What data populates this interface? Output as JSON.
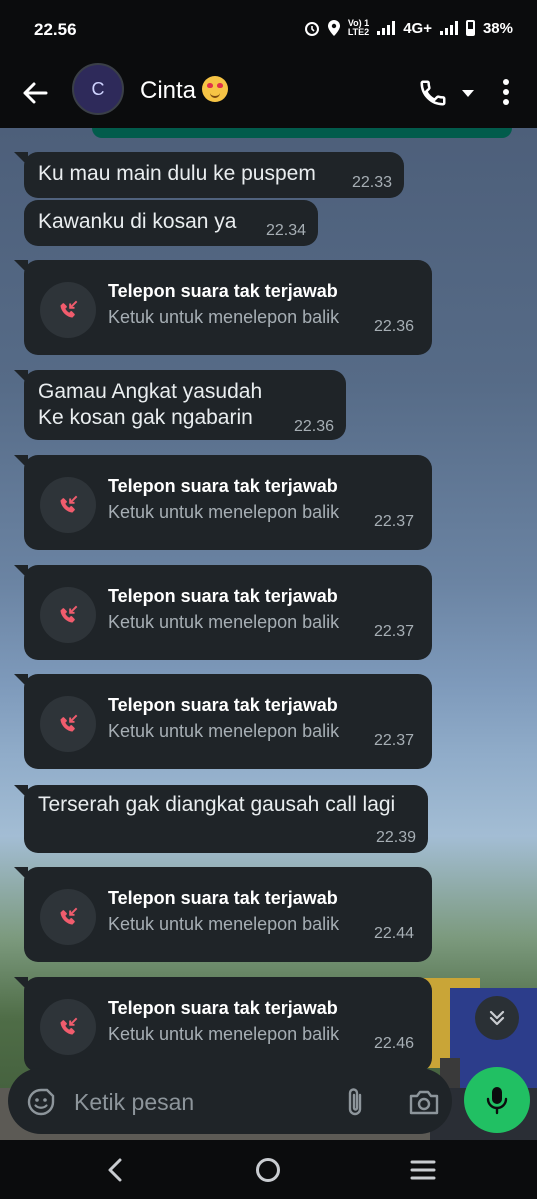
{
  "status_bar": {
    "time": "22.56",
    "volte_top": "Vo) 1",
    "volte_bottom": "LTE2",
    "network": "4G+",
    "battery": "38%"
  },
  "header": {
    "avatar_letter": "C",
    "contact_name": "Cinta"
  },
  "messages": [
    {
      "text": "Ku mau main dulu ke puspem",
      "time": "22.33"
    },
    {
      "text": "Kawanku di kosan ya",
      "time": "22.34"
    },
    {
      "text_line1": "Gamau Angkat yasudah",
      "text_line2": "Ke kosan gak ngabarin",
      "time": "22.36"
    },
    {
      "text": "Terserah gak diangkat gausah call lagi",
      "time": "22.39"
    }
  ],
  "missed_calls": [
    {
      "title": "Telepon suara tak terjawab",
      "subtitle": "Ketuk untuk menelepon balik",
      "time": "22.36"
    },
    {
      "title": "Telepon suara tak terjawab",
      "subtitle": "Ketuk untuk menelepon balik",
      "time": "22.37"
    },
    {
      "title": "Telepon suara tak terjawab",
      "subtitle": "Ketuk untuk menelepon balik",
      "time": "22.37"
    },
    {
      "title": "Telepon suara tak terjawab",
      "subtitle": "Ketuk untuk menelepon balik",
      "time": "22.37"
    },
    {
      "title": "Telepon suara tak terjawab",
      "subtitle": "Ketuk untuk menelepon balik",
      "time": "22.44"
    },
    {
      "title": "Telepon suara tak terjawab",
      "subtitle": "Ketuk untuk menelepon balik",
      "time": "22.46"
    }
  ],
  "composer": {
    "placeholder": "Ketik pesan"
  },
  "colors": {
    "accent": "#21c063",
    "bubble": "#1f2428",
    "missed_call_icon": "#f15c6d"
  }
}
